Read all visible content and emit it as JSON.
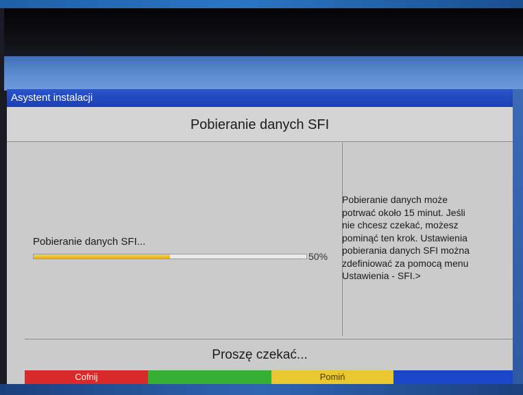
{
  "window": {
    "title": "Asystent instalacji"
  },
  "screen": {
    "title": "Pobieranie danych SFI"
  },
  "progress": {
    "label": "Pobieranie danych SFI...",
    "value": 0.5,
    "percent_text": "50%"
  },
  "info": {
    "text": "Pobieranie danych może\npotrwać około 15 minut. Jeśli\nnie chcesz czekać, możesz\npominąć ten krok. Ustawienia\npobierania danych SFI można\nzdefiniować za pomocą menu\nUstawienia - SFI.>"
  },
  "status": {
    "wait_text": "Proszę czekać..."
  },
  "buttons": {
    "red": {
      "label": "Cofnij",
      "color": "#d82a2a"
    },
    "green": {
      "label": "",
      "color": "#35b035"
    },
    "yellow": {
      "label": "Pomiń",
      "color": "#e8c82e"
    },
    "blue": {
      "label": "",
      "color": "#1a47c8"
    }
  },
  "colors": {
    "title_bar": "#1b3fb5",
    "panel": "#cbcbcb",
    "progress_fill": "#e8b020"
  }
}
